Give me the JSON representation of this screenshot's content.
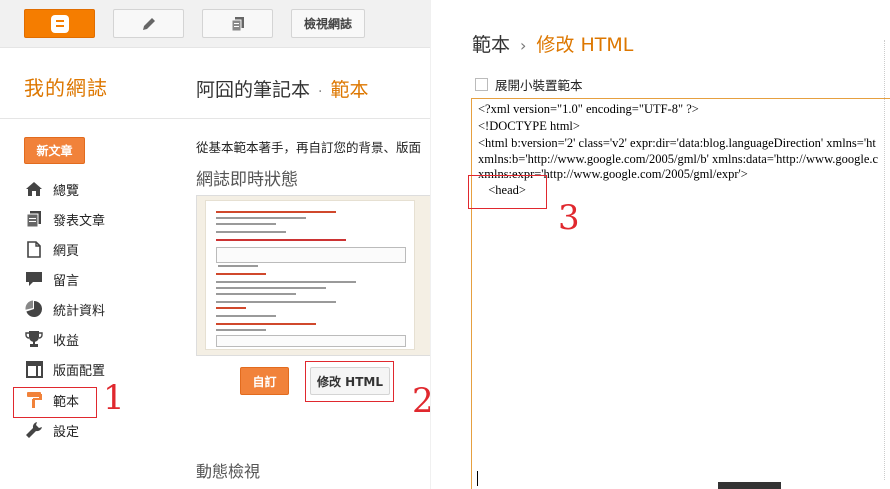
{
  "topbar": {
    "blogger_icon": "blogger-logo-icon",
    "new_post_icon": "pencil-icon",
    "posts_icon": "documents-icon",
    "view_blog_label": "檢視網誌"
  },
  "sidebar": {
    "blog_title": "我的網誌",
    "new_post_label": "新文章",
    "items": [
      {
        "label": "總覽",
        "icon": "home-icon"
      },
      {
        "label": "發表文章",
        "icon": "posts-icon"
      },
      {
        "label": "網頁",
        "icon": "page-icon"
      },
      {
        "label": "留言",
        "icon": "comment-icon"
      },
      {
        "label": "統計資料",
        "icon": "pie-chart-icon"
      },
      {
        "label": "收益",
        "icon": "trophy-icon"
      },
      {
        "label": "版面配置",
        "icon": "layout-icon"
      },
      {
        "label": "範本",
        "icon": "paint-roller-icon"
      },
      {
        "label": "設定",
        "icon": "wrench-icon"
      }
    ]
  },
  "main": {
    "blog_name": "阿囧的筆記本",
    "separator": "·",
    "section": "範本",
    "intro_text": "從基本範本著手，再自訂您的背景、版面",
    "live_title": "網誌即時狀態",
    "customize_label": "自訂",
    "edit_html_label": "修改 HTML",
    "dynamic_title": "動態檢視"
  },
  "editor_panel": {
    "crumb_root": "範本",
    "crumb_arrow": "›",
    "crumb_current": "修改 HTML",
    "mobile_label": "展開小裝置範本",
    "code_lines": [
      "<?xml version=\"1.0\" encoding=\"UTF-8\" ?>",
      "<!DOCTYPE html>",
      "<html b:version='2' class='v2' expr:dir='data:blog.languageDirection' xmlns='ht",
      "xmlns:b='http://www.google.com/2005/gml/b' xmlns:data='http://www.google.c",
      "xmlns:expr='http://www.google.com/2005/gml/expr'>",
      "  <head>"
    ]
  },
  "annotations": {
    "step1": "1",
    "step2": "2",
    "step3": "3",
    "color": "#e0282e"
  },
  "colors": {
    "accent": "#dd7700",
    "button_orange": "#f1823a",
    "editor_border": "#e6a040"
  }
}
